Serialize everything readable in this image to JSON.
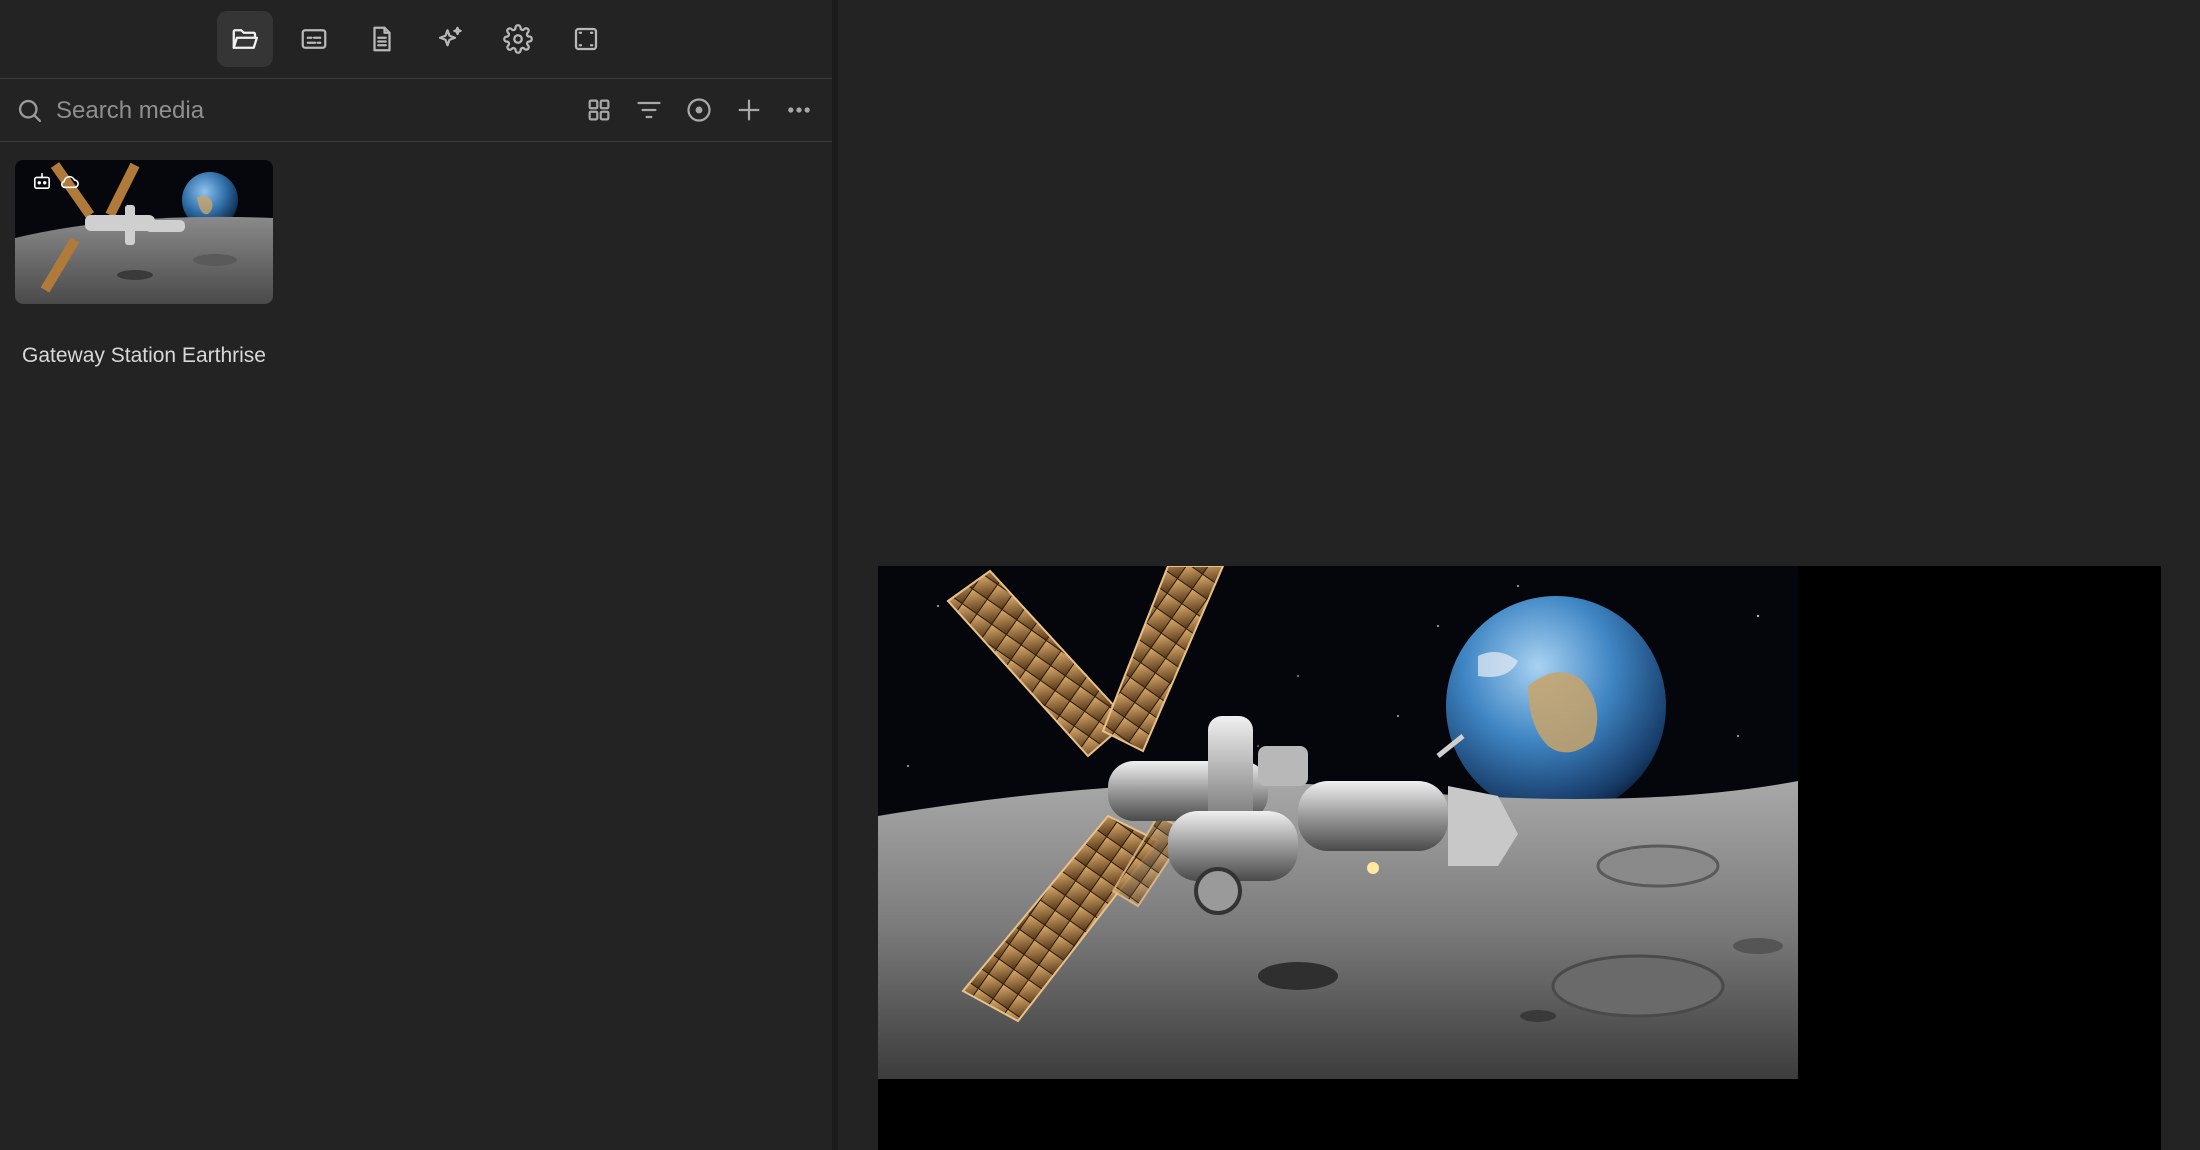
{
  "tabs": [
    {
      "name": "media-folder-tab",
      "icon": "folder-open-icon",
      "active": true
    },
    {
      "name": "captions-tab",
      "icon": "captions-icon",
      "active": false
    },
    {
      "name": "document-tab",
      "icon": "document-icon",
      "active": false
    },
    {
      "name": "ai-sparkle-tab",
      "icon": "sparkles-icon",
      "active": false
    },
    {
      "name": "settings-tab",
      "icon": "gear-icon",
      "active": false
    },
    {
      "name": "frame-tab",
      "icon": "frame-icon",
      "active": false
    }
  ],
  "search": {
    "placeholder": "Search media",
    "value": ""
  },
  "toolbar": {
    "icons": [
      "grid-view-icon",
      "filter-icon",
      "target-icon",
      "plus-icon",
      "more-icon"
    ]
  },
  "media": {
    "items": [
      {
        "title": "Gateway Station Earthrise",
        "badges": [
          "robot-icon",
          "cloud-icon"
        ]
      }
    ]
  },
  "preview": {
    "background": "#000000"
  }
}
